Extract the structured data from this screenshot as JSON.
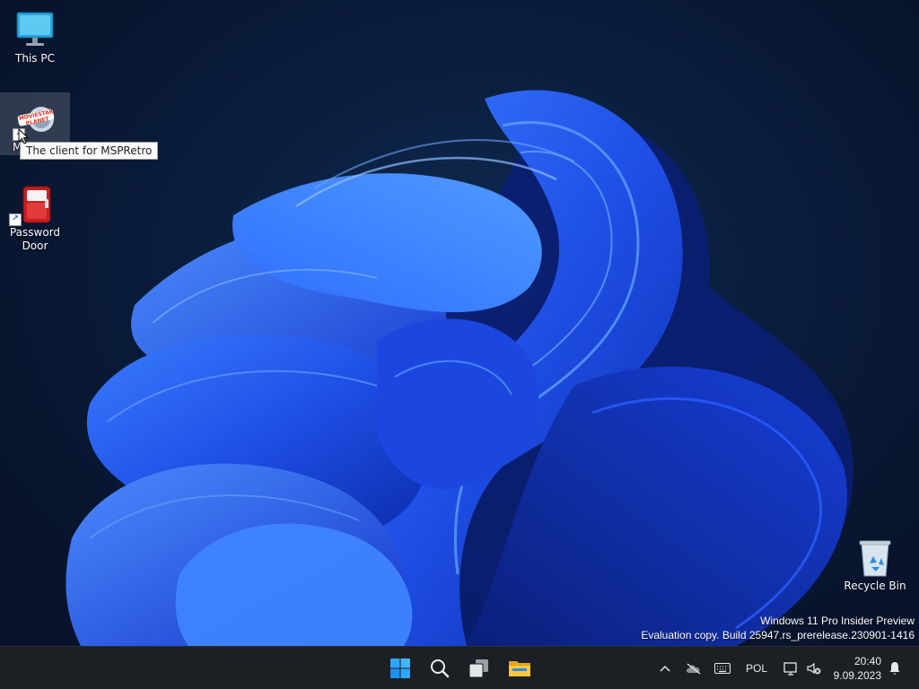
{
  "desktop": {
    "icons": [
      {
        "label": "This PC",
        "icon": "monitor-icon"
      },
      {
        "label": "M",
        "icon": "msp-retro-icon"
      },
      {
        "label": "Password\nDoor",
        "icon": "password-door-icon"
      },
      {
        "label": "Recycle Bin",
        "icon": "recycle-bin-icon"
      }
    ],
    "msp_logo_text": "MOVIESTAR PLANET",
    "tooltip": "The client for MSPRetro"
  },
  "watermark": {
    "line1": "Windows 11 Pro Insider Preview",
    "line2": "Evaluation copy. Build 25947.rs_prerelease.230901-1416"
  },
  "taskbar": {
    "apps": [
      "start-icon",
      "search-icon",
      "task-view-icon",
      "file-explorer-icon"
    ],
    "tray": {
      "language": "POL",
      "time": "20:40",
      "date": "9.09.2023"
    }
  },
  "colors": {
    "accent": "#1f5bff",
    "taskbar": "#1c1f24",
    "background": "#0a1d3c"
  }
}
